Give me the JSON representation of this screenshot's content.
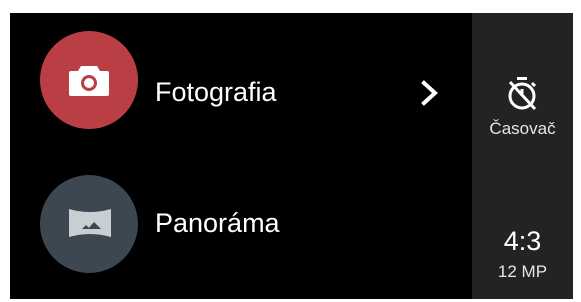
{
  "modes": [
    {
      "label": "Fotografia",
      "icon": "camera-icon",
      "color": "#b93f45"
    },
    {
      "label": "Panoráma",
      "icon": "panorama-icon",
      "color": "#3d4751"
    }
  ],
  "side_panel": {
    "timer_label": "Časovač",
    "timer_icon": "timer-off-icon",
    "ratio_value": "4:3",
    "ratio_resolution": "12 MP"
  },
  "colors": {
    "background": "#000000",
    "side_panel": "#222324",
    "text": "#ffffff"
  }
}
